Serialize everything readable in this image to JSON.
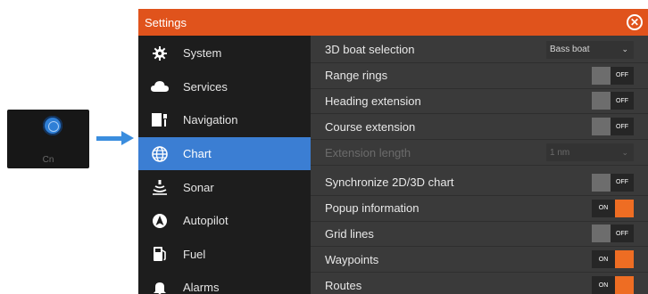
{
  "colors": {
    "title_bar": "#e0531c",
    "accent": "#3b7ed3",
    "toggle_on": "#ee6d23",
    "toggle_off": "#6d6d6d"
  },
  "mini_screen": {
    "label": "Cn"
  },
  "window": {
    "title": "Settings",
    "close_icon": "close-circle-icon"
  },
  "sidebar": {
    "items": [
      {
        "label": "System",
        "icon": "gear-icon",
        "active": false
      },
      {
        "label": "Services",
        "icon": "cloud-icon",
        "active": false
      },
      {
        "label": "Navigation",
        "icon": "navigation-icon",
        "active": false
      },
      {
        "label": "Chart",
        "icon": "globe-icon",
        "active": true
      },
      {
        "label": "Sonar",
        "icon": "sonar-icon",
        "active": false
      },
      {
        "label": "Autopilot",
        "icon": "autopilot-icon",
        "active": false
      },
      {
        "label": "Fuel",
        "icon": "fuel-icon",
        "active": false
      },
      {
        "label": "Alarms",
        "icon": "alarm-icon",
        "active": false
      }
    ]
  },
  "settings": {
    "boat_selection": {
      "label": "3D boat selection",
      "value": "Bass boat"
    },
    "range_rings": {
      "label": "Range rings",
      "state": "OFF"
    },
    "heading_extension": {
      "label": "Heading extension",
      "state": "OFF"
    },
    "course_extension": {
      "label": "Course extension",
      "state": "OFF"
    },
    "extension_length": {
      "label": "Extension length",
      "value": "1 nm"
    },
    "sync_chart": {
      "label": "Synchronize 2D/3D chart",
      "state": "OFF"
    },
    "popup_info": {
      "label": "Popup information",
      "state": "ON"
    },
    "grid_lines": {
      "label": "Grid lines",
      "state": "OFF"
    },
    "waypoints": {
      "label": "Waypoints",
      "state": "ON"
    },
    "routes": {
      "label": "Routes",
      "state": "ON"
    }
  }
}
